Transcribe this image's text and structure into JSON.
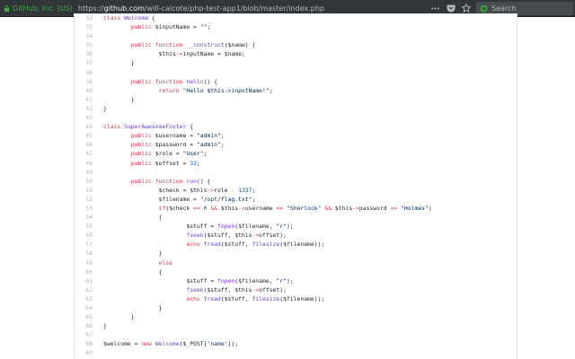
{
  "browser": {
    "identity": "GitHub, Inc. (US)",
    "url_prefix": "https://",
    "url_host": "github.com",
    "url_path": "/will-calcote/php-test-app1/blob/master/index.php",
    "search_placeholder": "Search"
  },
  "code": {
    "lines": [
      {
        "num": "32",
        "text": "class Welcome {"
      },
      {
        "num": "33",
        "text": "        public $inputName = \"\";"
      },
      {
        "num": "34",
        "text": ""
      },
      {
        "num": "35",
        "text": "        public function __construct($name) {"
      },
      {
        "num": "36",
        "text": "                $this->inputName = $name;"
      },
      {
        "num": "37",
        "text": "        }"
      },
      {
        "num": "38",
        "text": ""
      },
      {
        "num": "39",
        "text": "        public function hello() {"
      },
      {
        "num": "40",
        "text": "                return \"Hello $this->inputName!\";"
      },
      {
        "num": "41",
        "text": "        }"
      },
      {
        "num": "42",
        "text": "}"
      },
      {
        "num": "43",
        "text": ""
      },
      {
        "num": "44",
        "text": "class SuperAwesomeFooter {"
      },
      {
        "num": "45",
        "text": "        public $username = \"admin\";"
      },
      {
        "num": "46",
        "text": "        public $password = \"admin\";"
      },
      {
        "num": "47",
        "text": "        public $role = \"User\";"
      },
      {
        "num": "48",
        "text": "        public $offset = 32;"
      },
      {
        "num": "49",
        "text": ""
      },
      {
        "num": "50",
        "text": "        public function run() {"
      },
      {
        "num": "51",
        "text": "                $check = $this->role - 1337;"
      },
      {
        "num": "52",
        "text": "                $filename = \"/opt/flag.txt\";"
      },
      {
        "num": "53",
        "text": "                if($check == 0 && $this->username == \"Sherlock\" && $this->password == \"Holmes\")"
      },
      {
        "num": "54",
        "text": "                {"
      },
      {
        "num": "55",
        "text": "                        $stuff = fopen($filename, \"r\");"
      },
      {
        "num": "56",
        "text": "                        fseek($stuff, $this->offset);"
      },
      {
        "num": "57",
        "text": "                        echo fread($stuff, filesize($filename));"
      },
      {
        "num": "58",
        "text": "                }"
      },
      {
        "num": "59",
        "text": "                else"
      },
      {
        "num": "60",
        "text": "                {"
      },
      {
        "num": "61",
        "text": "                        $stuff = fopen($filename, \"r\");"
      },
      {
        "num": "62",
        "text": "                        fseek($stuff, $this->offset);"
      },
      {
        "num": "63",
        "text": "                        echo fread($stuff, filesize($filename));"
      },
      {
        "num": "64",
        "text": "                }"
      },
      {
        "num": "65",
        "text": "        }"
      },
      {
        "num": "66",
        "text": "}"
      },
      {
        "num": "67",
        "text": ""
      },
      {
        "num": "68",
        "text": "$welcome = new Welcome($_POST['name']);"
      },
      {
        "num": "69",
        "text": ""
      }
    ]
  }
}
